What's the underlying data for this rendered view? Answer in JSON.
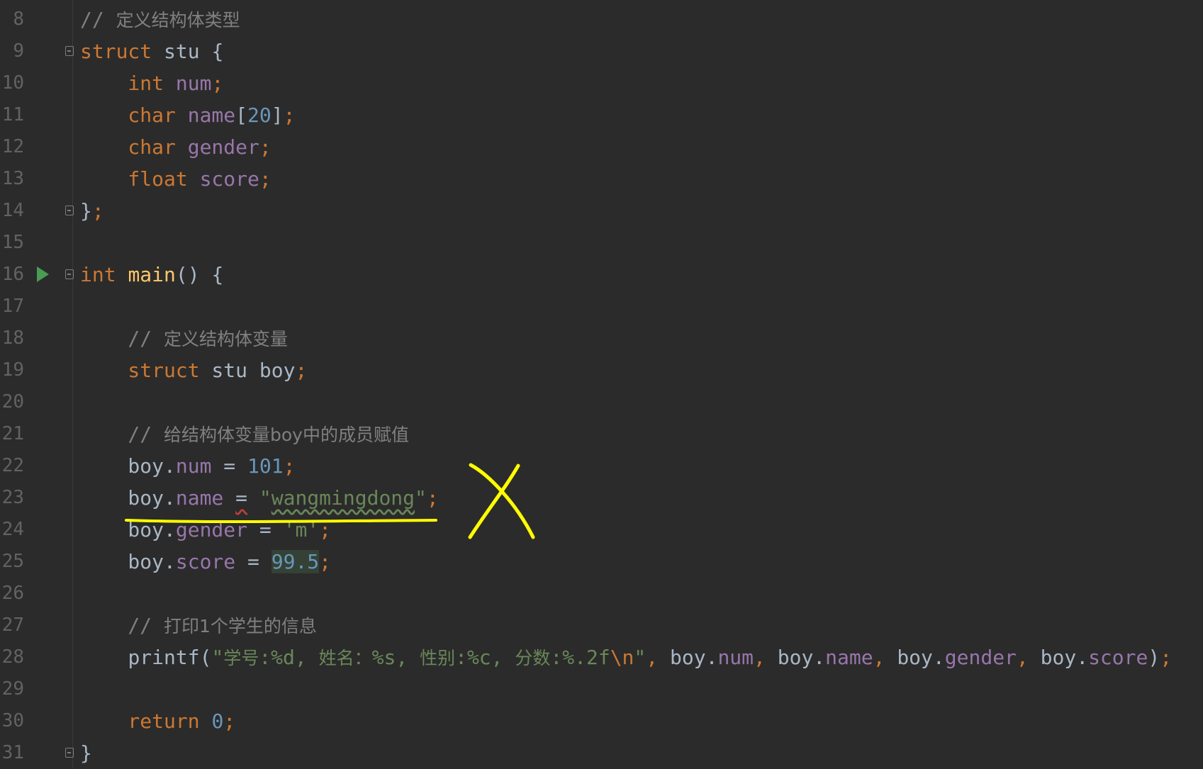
{
  "editor": {
    "lines": [
      {
        "ln": "8",
        "tokens": [
          [
            "cmt",
            "// "
          ],
          [
            "cmt cjk",
            "定义结构体类型"
          ]
        ]
      },
      {
        "ln": "9",
        "tokens": [
          [
            "kw",
            "struct"
          ],
          [
            "id",
            " stu {"
          ]
        ]
      },
      {
        "ln": "10",
        "tokens": [
          [
            "kw",
            "    int"
          ],
          [
            "id",
            " "
          ],
          [
            "fld",
            "num"
          ],
          [
            "kw",
            ";"
          ]
        ]
      },
      {
        "ln": "11",
        "tokens": [
          [
            "kw",
            "    char"
          ],
          [
            "id",
            " "
          ],
          [
            "fld",
            "name"
          ],
          [
            "id",
            "["
          ],
          [
            "num",
            "20"
          ],
          [
            "id",
            "]"
          ],
          [
            "kw",
            ";"
          ]
        ]
      },
      {
        "ln": "12",
        "tokens": [
          [
            "kw",
            "    char"
          ],
          [
            "id",
            " "
          ],
          [
            "fld",
            "gender"
          ],
          [
            "kw",
            ";"
          ]
        ]
      },
      {
        "ln": "13",
        "tokens": [
          [
            "kw",
            "    float"
          ],
          [
            "id",
            " "
          ],
          [
            "fld",
            "score"
          ],
          [
            "kw",
            ";"
          ]
        ]
      },
      {
        "ln": "14",
        "tokens": [
          [
            "id",
            "}"
          ],
          [
            "kw",
            ";"
          ]
        ]
      },
      {
        "ln": "15",
        "tokens": []
      },
      {
        "ln": "16",
        "tokens": [
          [
            "kw",
            "int"
          ],
          [
            "id",
            " "
          ],
          [
            "fn",
            "main"
          ],
          [
            "id",
            "() {"
          ]
        ]
      },
      {
        "ln": "17",
        "tokens": []
      },
      {
        "ln": "18",
        "tokens": [
          [
            "cmt",
            "    // "
          ],
          [
            "cmt cjk",
            "定义结构体变量"
          ]
        ]
      },
      {
        "ln": "19",
        "tokens": [
          [
            "kw",
            "    struct"
          ],
          [
            "id",
            " stu boy"
          ],
          [
            "kw",
            ";"
          ]
        ]
      },
      {
        "ln": "20",
        "tokens": []
      },
      {
        "ln": "21",
        "tokens": [
          [
            "cmt",
            "    // "
          ],
          [
            "cmt cjk",
            "给结构体变量boy中的成员赋值"
          ]
        ]
      },
      {
        "ln": "22",
        "tokens": [
          [
            "id",
            "    boy."
          ],
          [
            "fld",
            "num"
          ],
          [
            "id",
            " = "
          ],
          [
            "num",
            "101"
          ],
          [
            "kw",
            ";"
          ]
        ]
      },
      {
        "ln": "23",
        "tokens": [
          [
            "id",
            "    boy."
          ],
          [
            "fld",
            "name"
          ],
          [
            "id",
            " "
          ],
          [
            "id wavy-red",
            "="
          ],
          [
            "id",
            " "
          ],
          [
            "str",
            "\""
          ],
          [
            "str wavy-green",
            "wangmingdong"
          ],
          [
            "str",
            "\""
          ],
          [
            "kw",
            ";"
          ]
        ]
      },
      {
        "ln": "24",
        "tokens": [
          [
            "id",
            "    boy."
          ],
          [
            "fld",
            "gender"
          ],
          [
            "id",
            " = "
          ],
          [
            "str",
            "'m'"
          ],
          [
            "kw",
            ";"
          ]
        ]
      },
      {
        "ln": "25",
        "tokens": [
          [
            "id",
            "    boy."
          ],
          [
            "fld",
            "score"
          ],
          [
            "id",
            " = "
          ],
          [
            "num hl",
            "99.5"
          ],
          [
            "kw",
            ";"
          ]
        ]
      },
      {
        "ln": "26",
        "tokens": []
      },
      {
        "ln": "27",
        "tokens": [
          [
            "cmt",
            "    // "
          ],
          [
            "cmt cjk",
            "打印1个学生的信息"
          ]
        ]
      },
      {
        "ln": "28",
        "tokens": [
          [
            "id",
            "    "
          ],
          [
            "id",
            "printf("
          ],
          [
            "str",
            "\""
          ],
          [
            "str cjk",
            "学号"
          ],
          [
            "str",
            ":%d, "
          ],
          [
            "str cjk",
            "姓名："
          ],
          [
            "str",
            "%s, "
          ],
          [
            "str cjk",
            "性别"
          ],
          [
            "str",
            ":%c, "
          ],
          [
            "str cjk",
            "分数"
          ],
          [
            "str",
            ":%.2f"
          ],
          [
            "esc",
            "\\n"
          ],
          [
            "str",
            "\""
          ],
          [
            "kw",
            ", "
          ],
          [
            "id",
            "boy."
          ],
          [
            "fld",
            "num"
          ],
          [
            "kw",
            ", "
          ],
          [
            "id",
            "boy."
          ],
          [
            "fld",
            "name"
          ],
          [
            "kw",
            ", "
          ],
          [
            "id",
            "boy."
          ],
          [
            "fld",
            "gender"
          ],
          [
            "kw",
            ", "
          ],
          [
            "id",
            "boy."
          ],
          [
            "fld",
            "score"
          ],
          [
            "id",
            ")"
          ],
          [
            "kw",
            ";"
          ]
        ]
      },
      {
        "ln": "29",
        "tokens": []
      },
      {
        "ln": "30",
        "tokens": [
          [
            "kw",
            "    return"
          ],
          [
            "id",
            " "
          ],
          [
            "num",
            "0"
          ],
          [
            "kw",
            ";"
          ]
        ]
      },
      {
        "ln": "31",
        "tokens": [
          [
            "id",
            "}"
          ]
        ]
      }
    ],
    "run_icon_line": "16",
    "fold_lines": [
      "9",
      "14",
      "16",
      "31"
    ]
  },
  "colors": {
    "background": "#2b2b2b",
    "keyword": "#cc7832",
    "identifier": "#a9b7c6",
    "field": "#9876aa",
    "number": "#6897bb",
    "string": "#6a8759",
    "function": "#ffc66d",
    "comment": "#808080",
    "line_number": "#606366",
    "annotation": "#ffff00"
  },
  "icons": {
    "run": "run-triangle-icon",
    "fold": "fold-marker-icon"
  }
}
